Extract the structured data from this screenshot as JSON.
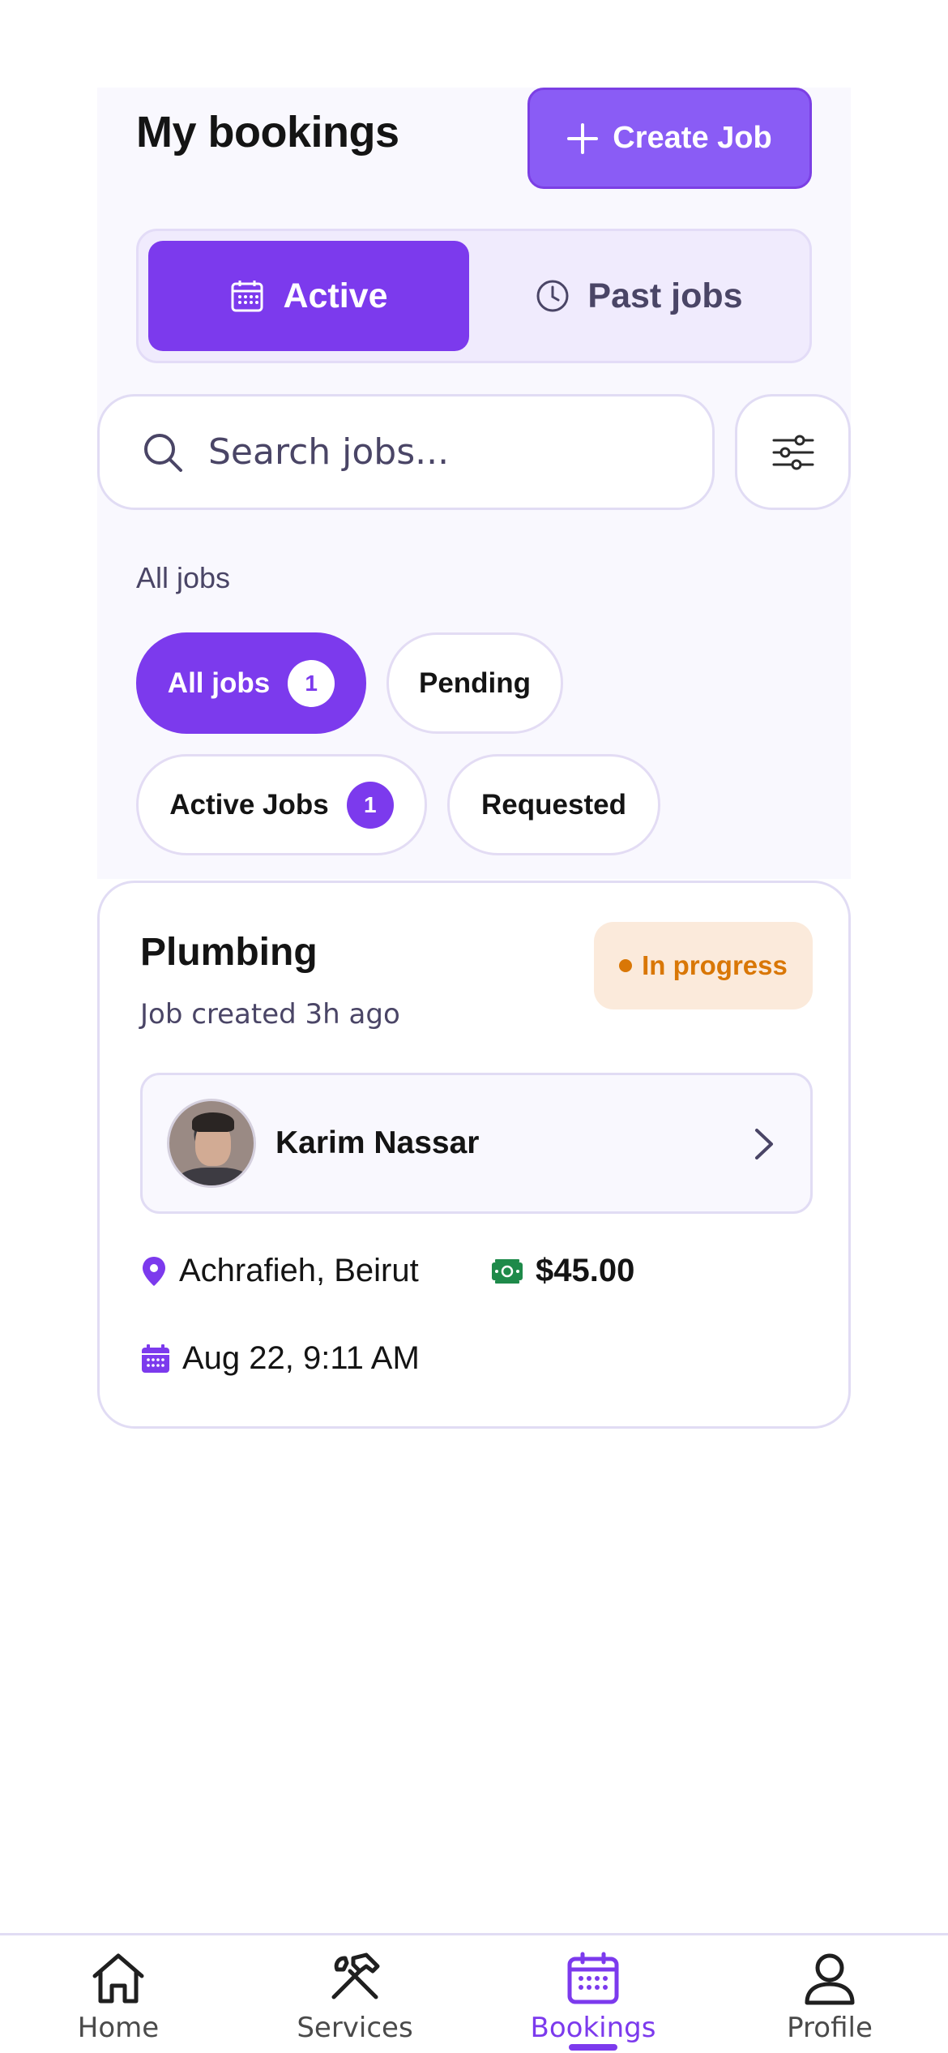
{
  "header": {
    "title": "My bookings",
    "create_button": "Create Job"
  },
  "segments": {
    "active": "Active",
    "past": "Past jobs"
  },
  "search": {
    "placeholder": "Search jobs..."
  },
  "filters": {
    "section_label": "All jobs",
    "chips": [
      {
        "label": "All jobs",
        "count": "1",
        "selected": true
      },
      {
        "label": "Pending"
      },
      {
        "label": "Active Jobs",
        "count": "1"
      },
      {
        "label": "Requested"
      }
    ]
  },
  "job": {
    "title": "Plumbing",
    "created": "Job created 3h ago",
    "status": "In progress",
    "worker_name": "Karim Nassar",
    "location": "Achrafieh, Beirut",
    "price": "$45.00",
    "date": "Aug 22, 9:11 AM"
  },
  "nav": [
    {
      "label": "Home",
      "icon": "home-icon"
    },
    {
      "label": "Services",
      "icon": "tools-icon"
    },
    {
      "label": "Bookings",
      "icon": "calendar-icon",
      "active": true
    },
    {
      "label": "Profile",
      "icon": "user-icon"
    }
  ],
  "colors": {
    "accent": "#7c3aed",
    "status_in_progress": "#d97706",
    "money_green": "#1e8a4a"
  }
}
